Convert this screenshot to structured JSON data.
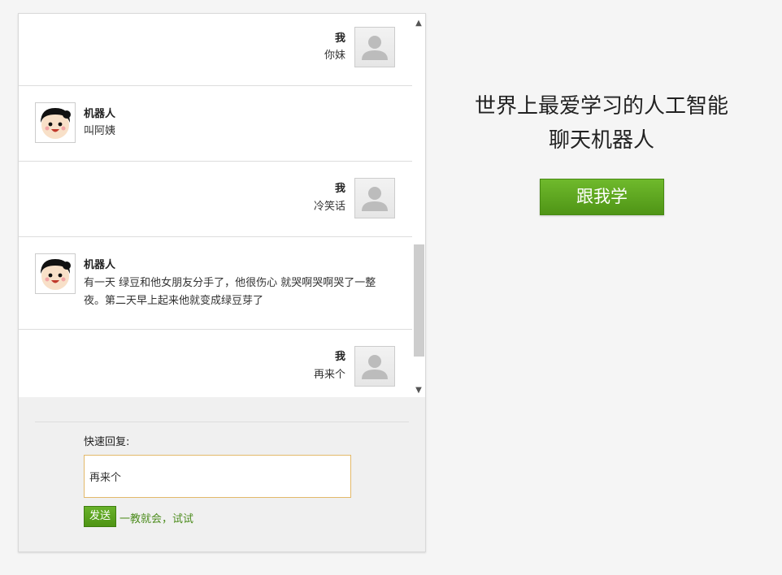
{
  "messages": [
    {
      "sender": "user",
      "name": "我",
      "text": "你妹"
    },
    {
      "sender": "bot",
      "name": "机器人",
      "text": "叫阿姨"
    },
    {
      "sender": "user",
      "name": "我",
      "text": "冷笑话"
    },
    {
      "sender": "bot",
      "name": "机器人",
      "text": "有一天 绿豆和他女朋友分手了，他很伤心 就哭啊哭啊哭了一整夜。第二天早上起来他就变成绿豆芽了"
    },
    {
      "sender": "user",
      "name": "我",
      "text": "再来个"
    }
  ],
  "reply": {
    "label": "快速回复:",
    "input_value": "再来个",
    "send_label": "发送",
    "tip": "一教就会，试试"
  },
  "hero": {
    "line1": "世界上最爱学习的人工智能",
    "line2": "聊天机器人",
    "button_label": "跟我学"
  },
  "colors": {
    "accent_green": "#5aa21f",
    "input_border": "#e3b96a"
  },
  "icons": {
    "user_avatar": "user-silhouette-icon",
    "bot_avatar": "cartoon-boy-face-icon",
    "scroll_up": "chevron-up-icon",
    "scroll_down": "chevron-down-icon"
  }
}
